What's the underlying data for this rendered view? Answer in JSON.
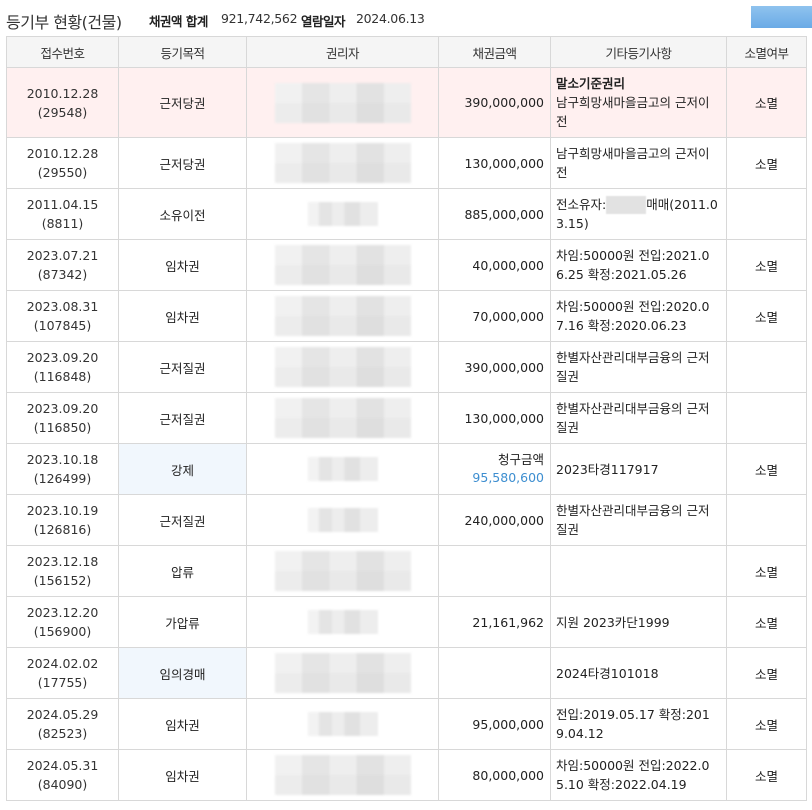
{
  "header": {
    "title": "등기부 현황(건물)",
    "sum_label": "채권액 합계",
    "sum_value": "921,742,562",
    "date_label": "열람일자",
    "date_value": "2024.06.13"
  },
  "columns": [
    "접수번호",
    "등기목적",
    "권리자",
    "채권금액",
    "기타등기사항",
    "소멸여부"
  ],
  "rows": [
    {
      "date": "2010.12.28",
      "no": "(29548)",
      "purpose": "근저당권",
      "amount": "390,000,000",
      "etc_strong": "말소기준권리",
      "etc": "남구희망새마을금고의 근저이전",
      "status": "소멸"
    },
    {
      "date": "2010.12.28",
      "no": "(29550)",
      "purpose": "근저당권",
      "amount": "130,000,000",
      "etc": "남구희망새마을금고의 근저이전",
      "status": "소멸"
    },
    {
      "date": "2011.04.15",
      "no": "(8811)",
      "purpose": "소유이전",
      "amount": "885,000,000",
      "etc_pre": "전소유자:",
      "etc_post": "매매(2011.03.15)",
      "status": ""
    },
    {
      "date": "2023.07.21",
      "no": "(87342)",
      "purpose": "임차권",
      "amount": "40,000,000",
      "etc": "차임:50000원 전입:2021.06.25 확정:2021.05.26",
      "status": "소멸"
    },
    {
      "date": "2023.08.31",
      "no": "(107845)",
      "purpose": "임차권",
      "amount": "70,000,000",
      "etc": "차임:50000원 전입:2020.07.16 확정:2020.06.23",
      "status": "소멸"
    },
    {
      "date": "2023.09.20",
      "no": "(116848)",
      "purpose": "근저질권",
      "amount": "390,000,000",
      "etc": "한별자산관리대부금융의 근저질권",
      "status": ""
    },
    {
      "date": "2023.09.20",
      "no": "(116850)",
      "purpose": "근저질권",
      "amount": "130,000,000",
      "etc": "한별자산관리대부금융의 근저질권",
      "status": ""
    },
    {
      "date": "2023.10.18",
      "no": "(126499)",
      "purpose": "강제",
      "claim_label": "청구금액",
      "claim_value": "95,580,600",
      "etc": "2023타경117917",
      "status": "소멸"
    },
    {
      "date": "2023.10.19",
      "no": "(126816)",
      "purpose": "근저질권",
      "amount": "240,000,000",
      "etc": "한별자산관리대부금융의 근저질권",
      "status": ""
    },
    {
      "date": "2023.12.18",
      "no": "(156152)",
      "purpose": "압류",
      "amount": "",
      "etc": "",
      "status": "소멸"
    },
    {
      "date": "2023.12.20",
      "no": "(156900)",
      "purpose": "가압류",
      "amount": "21,161,962",
      "etc": "지원 2023카단1999",
      "status": "소멸"
    },
    {
      "date": "2024.02.02",
      "no": "(17755)",
      "purpose": "임의경매",
      "amount": "",
      "etc": "2024타경101018",
      "status": "소멸"
    },
    {
      "date": "2024.05.29",
      "no": "(82523)",
      "purpose": "임차권",
      "amount": "95,000,000",
      "etc": "전입:2019.05.17 확정:2019.04.12",
      "status": "소멸"
    },
    {
      "date": "2024.05.31",
      "no": "(84090)",
      "purpose": "임차권",
      "amount": "80,000,000",
      "etc": "차임:50000원 전입:2022.05.10 확정:2022.04.19",
      "status": "소멸"
    }
  ]
}
